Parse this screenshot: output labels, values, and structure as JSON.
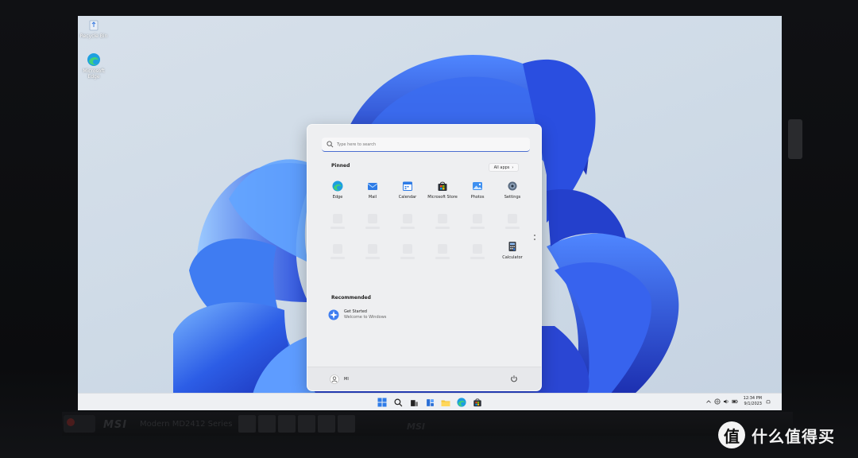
{
  "desktop": {
    "icons": [
      {
        "label": "Recycle Bin",
        "icon": "recycle-bin-icon"
      },
      {
        "label": "Microsoft Edge",
        "icon": "edge-icon"
      }
    ]
  },
  "start_menu": {
    "search": {
      "placeholder": "Type here to search"
    },
    "pinned_title": "Pinned",
    "all_apps_label": "All apps",
    "pinned": [
      {
        "label": "Edge",
        "icon": "edge-icon"
      },
      {
        "label": "Mail",
        "icon": "mail-icon"
      },
      {
        "label": "Calendar",
        "icon": "calendar-icon"
      },
      {
        "label": "Microsoft Store",
        "icon": "store-icon"
      },
      {
        "label": "Photos",
        "icon": "photos-icon"
      },
      {
        "label": "Settings",
        "icon": "settings-icon"
      },
      {
        "label": "Calculator",
        "icon": "calculator-icon"
      }
    ],
    "recommended_title": "Recommended",
    "recommended": [
      {
        "title": "Get Started",
        "subtitle": "Welcome to Windows",
        "icon": "get-started-icon"
      }
    ],
    "user_name": "MI"
  },
  "taskbar": {
    "icons": [
      "start-icon",
      "search-icon",
      "task-view-icon",
      "widgets-icon",
      "file-explorer-icon",
      "edge-icon",
      "store-icon"
    ],
    "time": "12:34 PM",
    "date": "9/1/2023"
  },
  "monitor": {
    "brand": "MSI",
    "model": "Modern MD2412 Series",
    "brand_repeat": "MSI"
  },
  "watermark": {
    "logo": "值",
    "text": "什么值得买"
  },
  "colors": {
    "accent": "#4a6ed0",
    "bloom_blue": "#2e4fd8"
  }
}
